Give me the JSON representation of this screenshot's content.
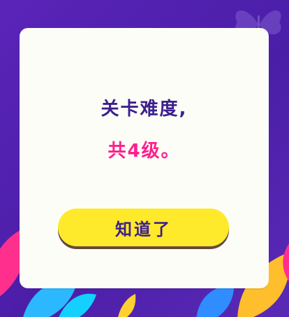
{
  "dialog": {
    "title": "关卡难度,",
    "subtitle": "共4级。",
    "button_label": "知道了"
  },
  "colors": {
    "background": "#4b1ea8",
    "card": "#fdfdf8",
    "title_text": "#3c1f8c",
    "subtitle_text": "#ff1f8b",
    "button": "#ffe92b"
  },
  "decorations": {
    "icons": [
      "butterfly-icon",
      "leaf-icon"
    ]
  }
}
